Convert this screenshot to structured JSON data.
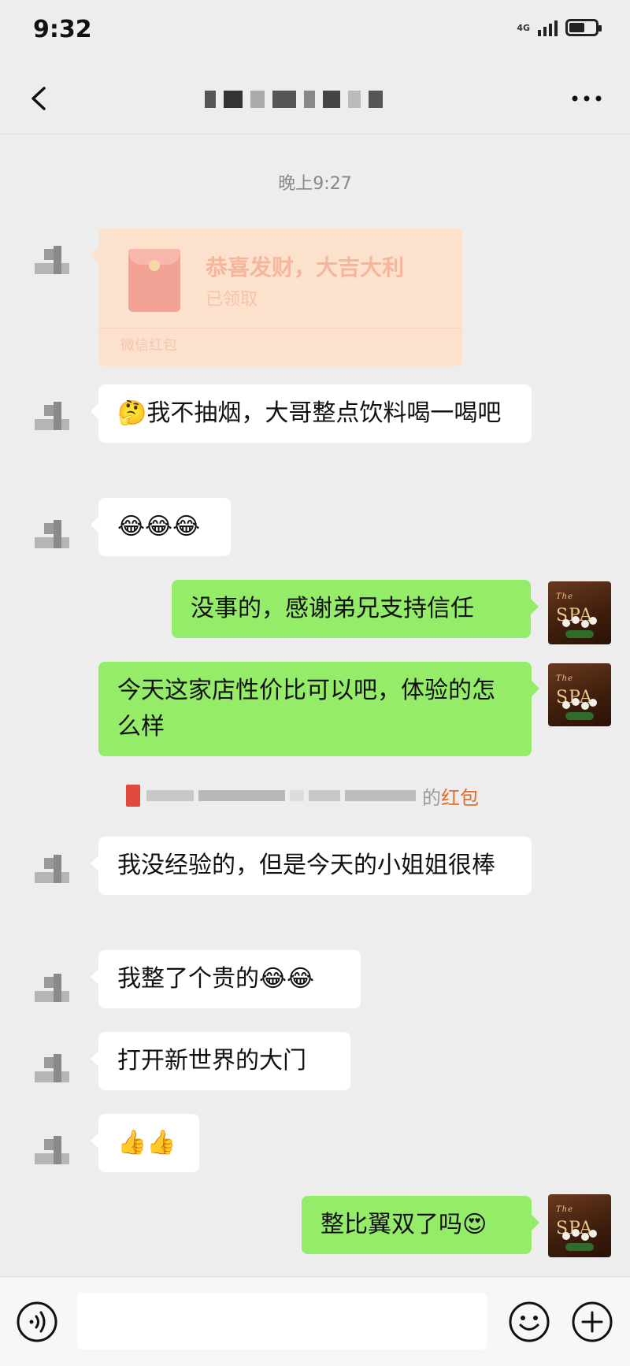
{
  "status_bar": {
    "time": "9:32",
    "network": "4G",
    "battery_level": 0.6
  },
  "header": {
    "back_icon": "chevron-left-icon",
    "more_icon": "more-dots-icon"
  },
  "timestamp": "晚上9:27",
  "red_packet": {
    "title": "恭喜发财，大吉大利",
    "status": "已领取",
    "footer": "微信红包"
  },
  "messages": [
    {
      "side": "left",
      "text": "我不抽烟，大哥整点饮料喝一喝吧",
      "emoji": "🤔"
    },
    {
      "side": "left",
      "text": "😂😂😂"
    },
    {
      "side": "right",
      "text": "没事的，感谢弟兄支持信任"
    },
    {
      "side": "right",
      "text": "今天这家店性价比可以吧，体验的怎么样"
    },
    {
      "side": "left",
      "text": "我没经验的，但是今天的小姐姐很棒"
    },
    {
      "side": "left",
      "text": "我整了个贵的😂😂"
    },
    {
      "side": "left",
      "text": "打开新世界的大门"
    },
    {
      "side": "left",
      "text": "👍👍"
    },
    {
      "side": "right",
      "text": "整比翼双了吗😍"
    }
  ],
  "claim_notice": {
    "suffix": "的",
    "link": "红包"
  },
  "self_avatar": {
    "top": "The",
    "main": "SPA"
  },
  "input_bar": {
    "voice_icon": "voice-icon",
    "emoji_icon": "emoji-icon",
    "plus_icon": "plus-icon"
  },
  "colors": {
    "background": "#ededed",
    "self_bubble": "#95ec69",
    "other_bubble": "#ffffff",
    "red_packet": "#fce2cd"
  }
}
